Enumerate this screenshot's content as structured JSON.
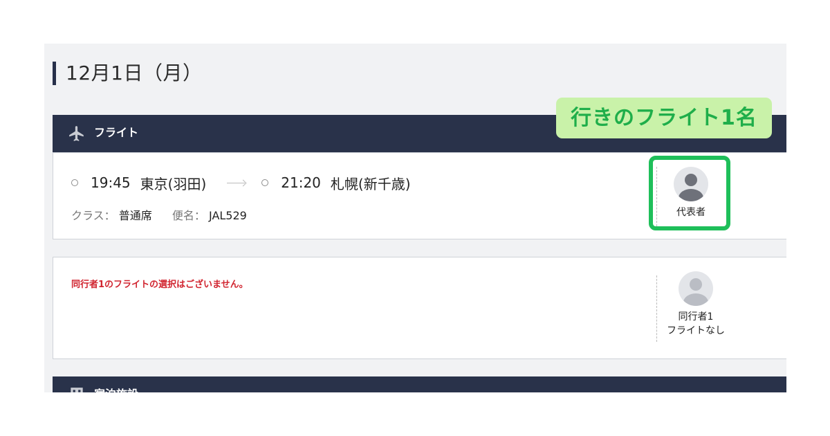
{
  "date_title": "12月1日（月）",
  "flight_section": {
    "label": "フライト",
    "badge": "行きのフライト1名",
    "departure": {
      "time": "19:45",
      "airport": "東京(羽田)"
    },
    "arrival": {
      "time": "21:20",
      "airport": "札幌(新千歳)"
    },
    "class_label": "クラス：",
    "class_value": "普通席",
    "flight_label": "便名：",
    "flight_value": "JAL529",
    "lead_passenger": "代表者"
  },
  "companion": {
    "message": "同行者1のフライトの選択はございません。",
    "name": "同行者1",
    "status": "フライトなし"
  },
  "lodging_section": {
    "label": "宿泊施設"
  },
  "colors": {
    "header_bg": "#29324a",
    "badge_bg": "#c9f2a9",
    "badge_text": "#1fae4a",
    "highlight": "#1fbf5a",
    "error_text": "#d1242f"
  }
}
